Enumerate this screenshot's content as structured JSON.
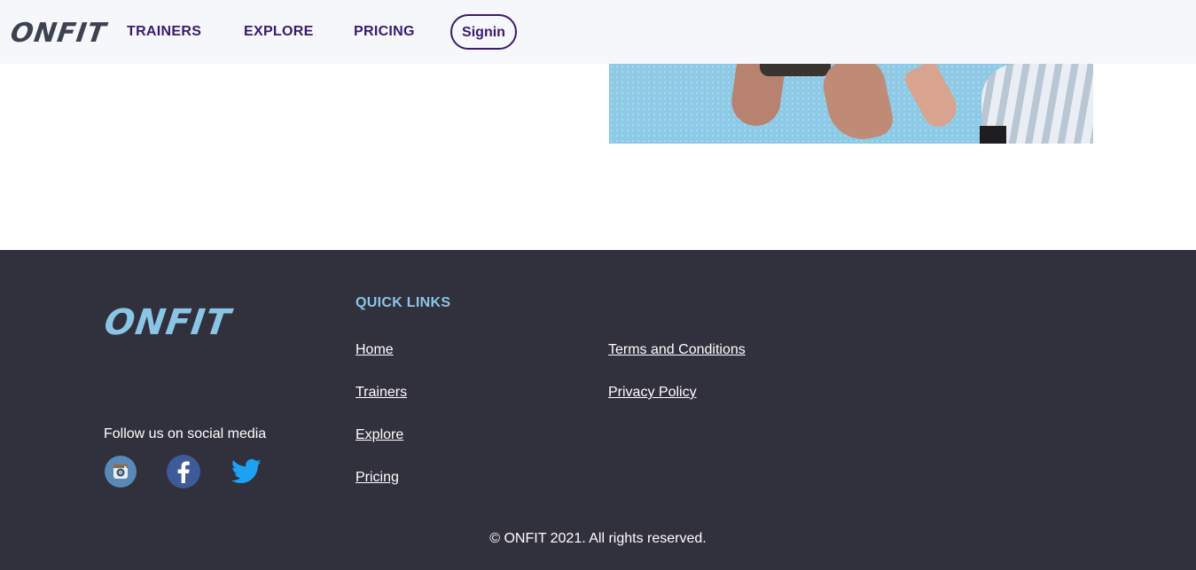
{
  "header": {
    "logo": "ONFIT",
    "nav": {
      "trainers": "TRAINERS",
      "explore": "EXPLORE",
      "pricing": "PRICING"
    },
    "signin_label": "Signin",
    "colors": {
      "background": "#f6f7fa",
      "nav_text": "#3a1a6e"
    }
  },
  "footer": {
    "logo": "ONFIT",
    "follow_text": "Follow us on social media",
    "social": [
      {
        "icon": "instagram-icon"
      },
      {
        "icon": "facebook-icon"
      },
      {
        "icon": "twitter-icon"
      }
    ],
    "quick_links_title": "QUICK LINKS",
    "links_col1": [
      "Home",
      "Trainers",
      "Explore",
      "Pricing"
    ],
    "links_col2": [
      "Terms and Conditions",
      "Privacy Policy"
    ],
    "copyright": "© ONFIT 2021. All rights reserved.",
    "colors": {
      "background": "#31303d",
      "accent": "#8ac5e6"
    }
  }
}
